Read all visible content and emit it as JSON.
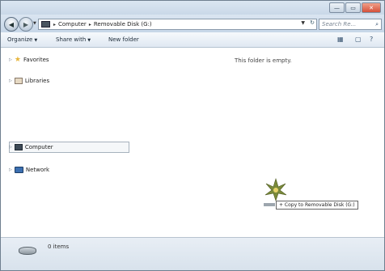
{
  "window": {
    "minimize_glyph": "—",
    "maximize_glyph": "▭",
    "close_glyph": "✕"
  },
  "nav": {
    "back_glyph": "◀",
    "forward_glyph": "▶",
    "dropdown_glyph": "▼",
    "breadcrumb": [
      "Computer",
      "Removable Disk (G:)"
    ],
    "separator": "▸",
    "refresh_glyph": "↻"
  },
  "search": {
    "placeholder": "Search Re...",
    "icon": "search-icon",
    "glyph": "⌕"
  },
  "toolbar": {
    "organize": "Organize",
    "share_with": "Share with",
    "new_folder": "New folder",
    "view_glyph": "▦",
    "pane_glyph": "▢",
    "help_glyph": "?",
    "arrow": "▼"
  },
  "sidebar": {
    "items": [
      {
        "label": "Favorites",
        "icon": "star-icon"
      },
      {
        "label": "Libraries",
        "icon": "library-icon"
      },
      {
        "label": "Computer",
        "icon": "computer-icon"
      },
      {
        "label": "Network",
        "icon": "network-icon"
      }
    ],
    "expand_glyph": "▷"
  },
  "content": {
    "empty_message": "This folder is empty.",
    "drag_tooltip": "+ Copy to Removable Disk (G:)"
  },
  "status": {
    "items_count": "0 items"
  },
  "colors": {
    "accent": "#c7d7e8",
    "close_button": "#d4503a"
  }
}
